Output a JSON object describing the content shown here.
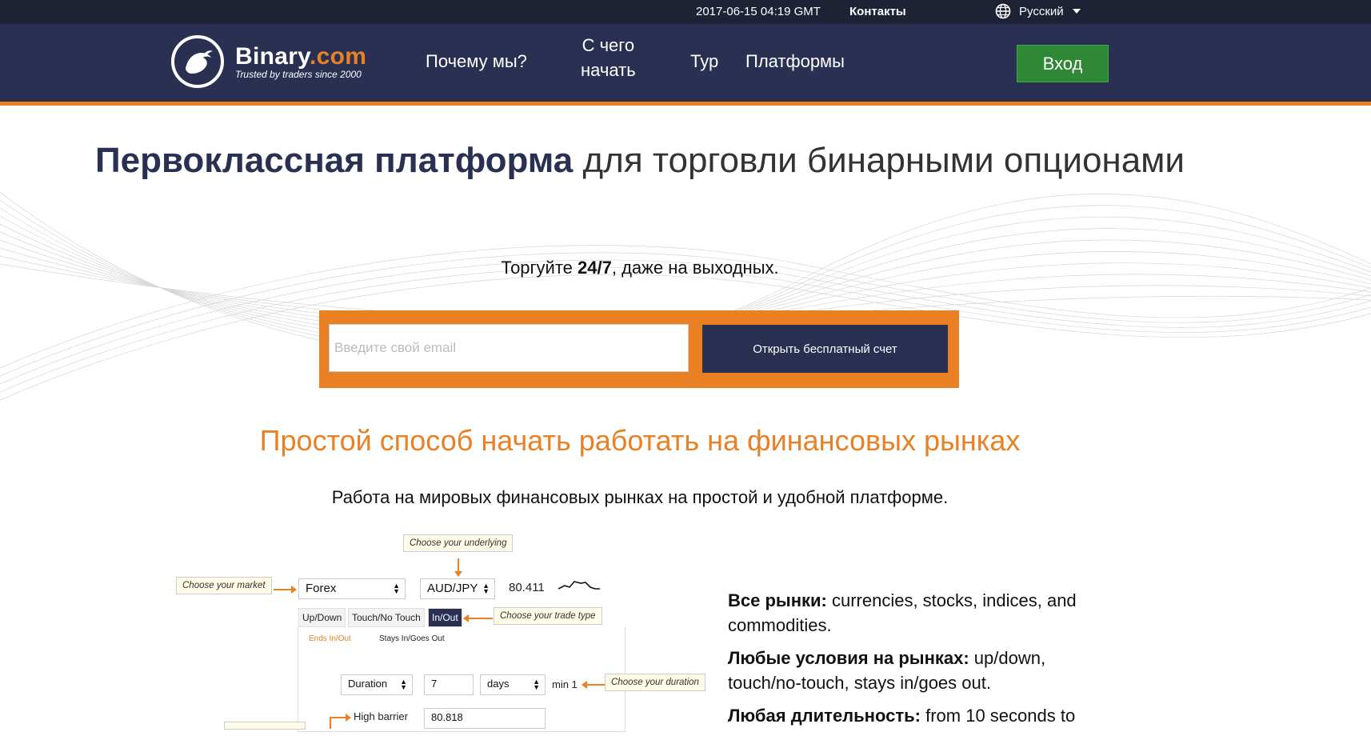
{
  "topbar": {
    "time": "2017-06-15 04:19 GMT",
    "contacts": "Контакты",
    "language": "Русский"
  },
  "brand": {
    "name": "Binary",
    "dotcom": ".com",
    "tagline": "Trusted by traders since 2000"
  },
  "nav": {
    "why": "Почему мы?",
    "start_line1": "С чего",
    "start_line2": "начать",
    "tour": "Тур",
    "platforms": "Платформы",
    "login": "Вход"
  },
  "hero": {
    "title_bold": "Первоклассная платформа",
    "title_rest": " для торговли бинарными опционами",
    "subtitle_pre": "Торгуйте ",
    "subtitle_bold": "24/7",
    "subtitle_post": ", даже на выходных."
  },
  "signup": {
    "email_placeholder": "Введите свой email",
    "button": "Открыть бесплатный счет"
  },
  "section": {
    "title": "Простой способ начать работать на финансовых рынках",
    "subtitle": "Работа на мировых финансовых рынках на простой и удобной платформе."
  },
  "demo": {
    "note_underlying": "Choose your underlying",
    "note_market": "Choose your market",
    "note_trade_type": "Choose your trade type",
    "note_duration": "Choose your duration",
    "market": "Forex",
    "symbol": "AUD/JPY",
    "price": "80.411",
    "tabs": [
      "Up/Down",
      "Touch/No Touch",
      "In/Out"
    ],
    "subtabs": [
      "Ends In/Out",
      "Stays In/Goes Out"
    ],
    "duration_label": "Duration",
    "duration_value": "7",
    "duration_unit": "days",
    "min_label": "min 1",
    "high_barrier_label": "High barrier",
    "high_barrier_value": "80.818"
  },
  "features": [
    {
      "bold": "Все рынки:",
      "text": " currencies, stocks, indices, and commodities."
    },
    {
      "bold": "Любые условия на рынках:",
      "text": " up/down, touch/no-touch, stays in/goes out."
    },
    {
      "bold": "Любая длительность:",
      "text": " from 10 seconds to"
    }
  ],
  "colors": {
    "navy": "#2a3052",
    "orange": "#e98024",
    "green": "#2e8836",
    "topbar": "#1e2235"
  }
}
